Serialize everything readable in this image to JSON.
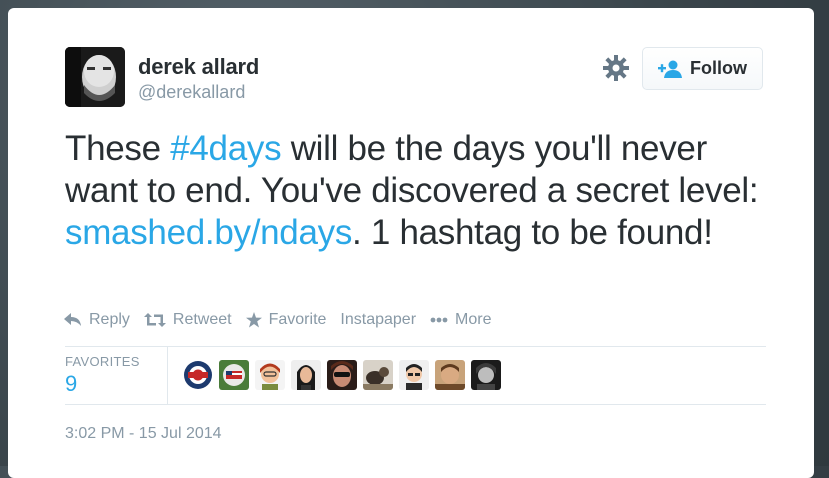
{
  "user": {
    "display_name": "derek allard",
    "handle": "@derekallard"
  },
  "follow_button": {
    "label": "Follow"
  },
  "tweet": {
    "segments": [
      {
        "text": "These ",
        "link": false
      },
      {
        "text": "#4days",
        "link": true
      },
      {
        "text": " will be the days you'll never want to end. You've discovered a secret level: ",
        "link": false
      },
      {
        "text": "smashed.by/ndays",
        "link": true
      },
      {
        "text": ". 1 hashtag to be found!",
        "link": false
      }
    ]
  },
  "actions": [
    {
      "label": "Reply",
      "icon": "reply-icon"
    },
    {
      "label": "Retweet",
      "icon": "retweet-icon"
    },
    {
      "label": "Favorite",
      "icon": "star-icon"
    },
    {
      "label": "Instapaper",
      "icon": ""
    },
    {
      "label": "More",
      "icon": "more-dots-icon"
    }
  ],
  "stats": {
    "favorites_label": "FAVORITES",
    "favorites_count": "9"
  },
  "favoriters": [
    {
      "name": "favoriter-1"
    },
    {
      "name": "favoriter-2"
    },
    {
      "name": "favoriter-3"
    },
    {
      "name": "favoriter-4"
    },
    {
      "name": "favoriter-5"
    },
    {
      "name": "favoriter-6"
    },
    {
      "name": "favoriter-7"
    },
    {
      "name": "favoriter-8"
    },
    {
      "name": "favoriter-9"
    }
  ],
  "timestamp": "3:02 PM - 15 Jul 2014",
  "colors": {
    "link": "#2aa7e6",
    "text": "#292f33",
    "muted": "#8899a6",
    "border": "#e1e8ed"
  }
}
